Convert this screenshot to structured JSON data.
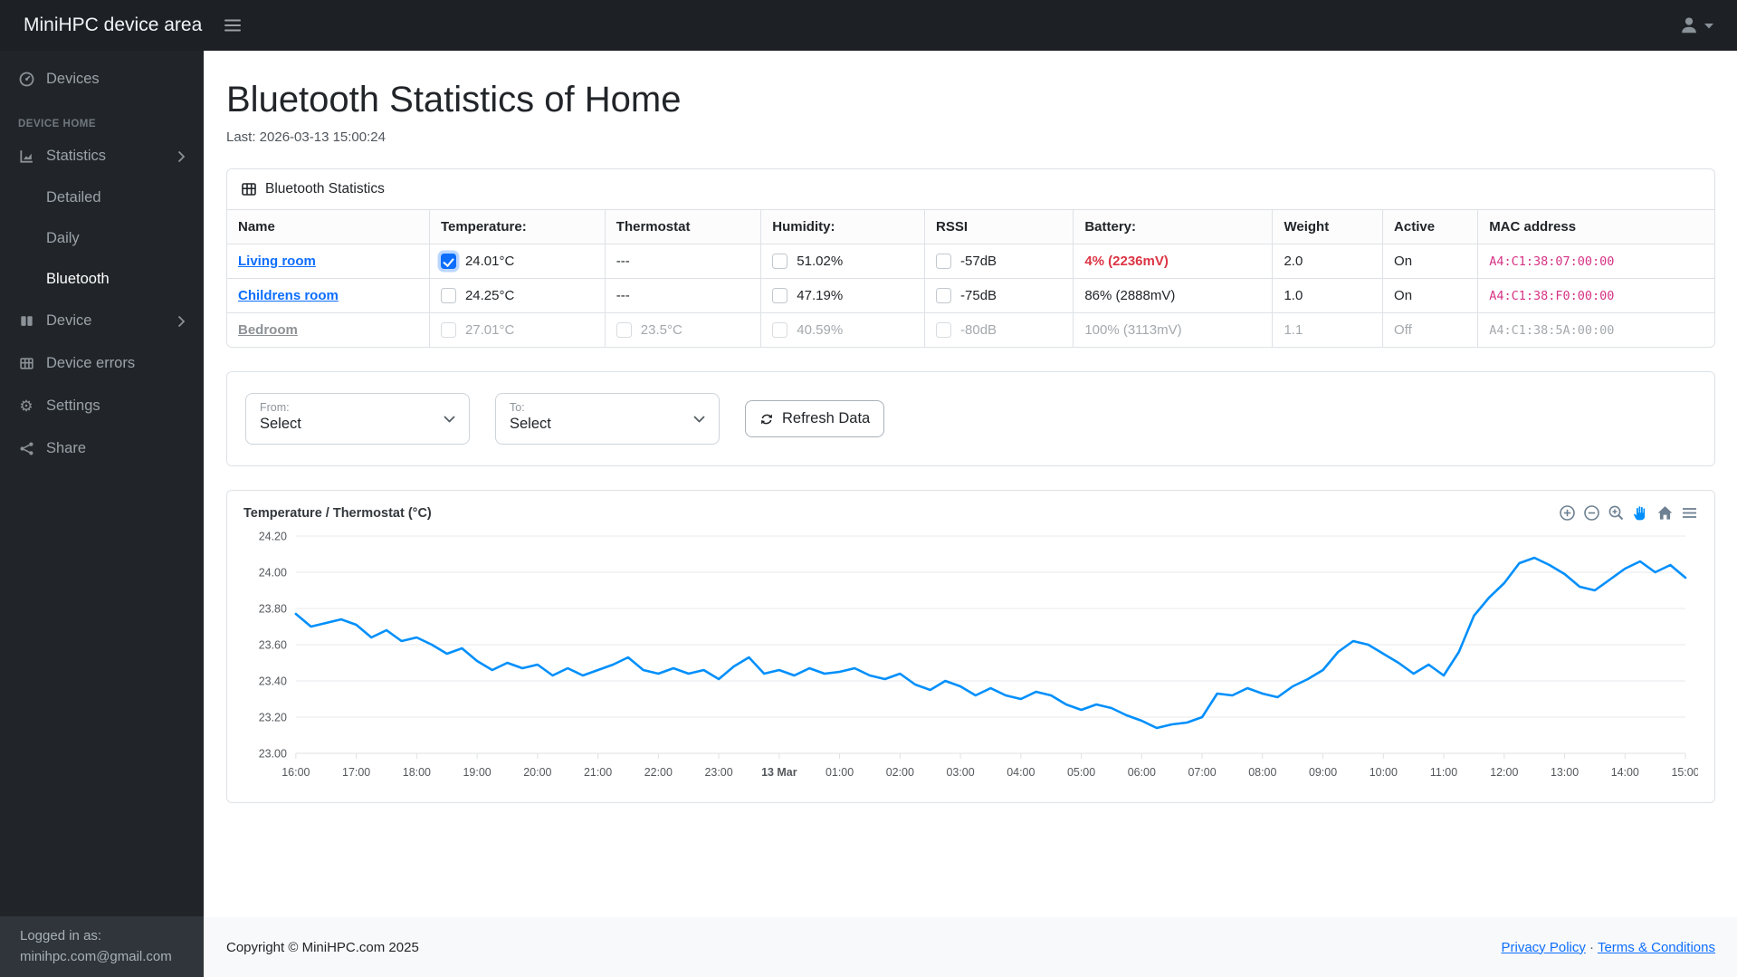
{
  "app": {
    "brand": "MiniHPC device area"
  },
  "sidebar": {
    "section_label": "DEVICE HOME",
    "items": {
      "devices": "Devices",
      "statistics": "Statistics",
      "detailed": "Detailed",
      "daily": "Daily",
      "bluetooth": "Bluetooth",
      "device": "Device",
      "device_errors": "Device errors",
      "settings": "Settings",
      "share": "Share"
    },
    "footer": {
      "line1": "Logged in as:",
      "line2": "minihpc.com@gmail.com"
    }
  },
  "page": {
    "title": "Bluetooth Statistics of Home",
    "last": "Last: 2026-03-13 15:00:24"
  },
  "stats_card": {
    "header": "Bluetooth Statistics",
    "columns": [
      "Name",
      "Temperature:",
      "Thermostat",
      "Humidity:",
      "RSSI",
      "Battery:",
      "Weight",
      "Active",
      "MAC address"
    ],
    "rows": [
      {
        "name": "Living room",
        "temp": "24.01°C",
        "temp_checked": true,
        "thermostat": "---",
        "humidity": "51.02%",
        "humidity_checked": false,
        "rssi": "-57dB",
        "rssi_checked": false,
        "battery": "4% (2236mV)",
        "battery_alert": true,
        "weight": "2.0",
        "active": "On",
        "mac": "A4:C1:38:07:00:00",
        "muted": false
      },
      {
        "name": "Childrens room",
        "temp": "24.25°C",
        "temp_checked": false,
        "thermostat": "---",
        "humidity": "47.19%",
        "humidity_checked": false,
        "rssi": "-75dB",
        "rssi_checked": false,
        "battery": "86% (2888mV)",
        "battery_alert": false,
        "weight": "1.0",
        "active": "On",
        "mac": "A4:C1:38:F0:00:00",
        "muted": false
      },
      {
        "name": "Bedroom",
        "temp": "27.01°C",
        "temp_checked": false,
        "thermostat": "23.5°C",
        "thermostat_checked": false,
        "humidity": "40.59%",
        "humidity_checked": false,
        "rssi": "-80dB",
        "rssi_checked": false,
        "battery": "100% (3113mV)",
        "battery_alert": false,
        "weight": "1.1",
        "active": "Off",
        "mac": "A4:C1:38:5A:00:00",
        "muted": true
      }
    ]
  },
  "filters": {
    "from_label": "From:",
    "from_value": "Select",
    "to_label": "To:",
    "to_value": "Select",
    "refresh_label": "Refresh Data"
  },
  "chart_data": {
    "type": "line",
    "title": "Temperature / Thermostat (°C)",
    "x_categories": [
      "16:00",
      "17:00",
      "18:00",
      "19:00",
      "20:00",
      "21:00",
      "22:00",
      "23:00",
      "13 Mar",
      "01:00",
      "02:00",
      "03:00",
      "04:00",
      "05:00",
      "06:00",
      "07:00",
      "08:00",
      "09:00",
      "10:00",
      "11:00",
      "12:00",
      "13:00",
      "14:00",
      "15:00"
    ],
    "bold_category_index": 8,
    "ylim": [
      23.0,
      24.2
    ],
    "ytick": 0.2,
    "x_hours_span": 23,
    "grid": true,
    "legend": "none",
    "toolbar": [
      "zoom-in",
      "zoom-out",
      "selection-zoom",
      "pan",
      "home",
      "menu"
    ],
    "series": [
      {
        "name": "Temperature",
        "color": "#008FFB",
        "points": [
          [
            0,
            23.77
          ],
          [
            0.25,
            23.7
          ],
          [
            0.5,
            23.72
          ],
          [
            0.75,
            23.74
          ],
          [
            1,
            23.71
          ],
          [
            1.25,
            23.64
          ],
          [
            1.5,
            23.68
          ],
          [
            1.75,
            23.62
          ],
          [
            2,
            23.64
          ],
          [
            2.25,
            23.6
          ],
          [
            2.5,
            23.55
          ],
          [
            2.75,
            23.58
          ],
          [
            3,
            23.51
          ],
          [
            3.25,
            23.46
          ],
          [
            3.5,
            23.5
          ],
          [
            3.75,
            23.47
          ],
          [
            4,
            23.49
          ],
          [
            4.25,
            23.43
          ],
          [
            4.5,
            23.47
          ],
          [
            4.75,
            23.43
          ],
          [
            5,
            23.46
          ],
          [
            5.25,
            23.49
          ],
          [
            5.5,
            23.53
          ],
          [
            5.75,
            23.46
          ],
          [
            6,
            23.44
          ],
          [
            6.25,
            23.47
          ],
          [
            6.5,
            23.44
          ],
          [
            6.75,
            23.46
          ],
          [
            7,
            23.41
          ],
          [
            7.25,
            23.48
          ],
          [
            7.5,
            23.53
          ],
          [
            7.75,
            23.44
          ],
          [
            8,
            23.46
          ],
          [
            8.25,
            23.43
          ],
          [
            8.5,
            23.47
          ],
          [
            8.75,
            23.44
          ],
          [
            9,
            23.45
          ],
          [
            9.25,
            23.47
          ],
          [
            9.5,
            23.43
          ],
          [
            9.75,
            23.41
          ],
          [
            10,
            23.44
          ],
          [
            10.25,
            23.38
          ],
          [
            10.5,
            23.35
          ],
          [
            10.75,
            23.4
          ],
          [
            11,
            23.37
          ],
          [
            11.25,
            23.32
          ],
          [
            11.5,
            23.36
          ],
          [
            11.75,
            23.32
          ],
          [
            12,
            23.3
          ],
          [
            12.25,
            23.34
          ],
          [
            12.5,
            23.32
          ],
          [
            12.75,
            23.27
          ],
          [
            13,
            23.24
          ],
          [
            13.25,
            23.27
          ],
          [
            13.5,
            23.25
          ],
          [
            13.75,
            23.21
          ],
          [
            14,
            23.18
          ],
          [
            14.25,
            23.14
          ],
          [
            14.5,
            23.16
          ],
          [
            14.75,
            23.17
          ],
          [
            15,
            23.2
          ],
          [
            15.25,
            23.33
          ],
          [
            15.5,
            23.32
          ],
          [
            15.75,
            23.36
          ],
          [
            16,
            23.33
          ],
          [
            16.25,
            23.31
          ],
          [
            16.5,
            23.37
          ],
          [
            16.75,
            23.41
          ],
          [
            17,
            23.46
          ],
          [
            17.25,
            23.56
          ],
          [
            17.5,
            23.62
          ],
          [
            17.75,
            23.6
          ],
          [
            18,
            23.55
          ],
          [
            18.25,
            23.5
          ],
          [
            18.5,
            23.44
          ],
          [
            18.75,
            23.49
          ],
          [
            19,
            23.43
          ],
          [
            19.25,
            23.56
          ],
          [
            19.5,
            23.76
          ],
          [
            19.75,
            23.86
          ],
          [
            20,
            23.94
          ],
          [
            20.25,
            24.05
          ],
          [
            20.5,
            24.08
          ],
          [
            20.75,
            24.04
          ],
          [
            21,
            23.99
          ],
          [
            21.25,
            23.92
          ],
          [
            21.5,
            23.9
          ],
          [
            21.75,
            23.96
          ],
          [
            22,
            24.02
          ],
          [
            22.25,
            24.06
          ],
          [
            22.5,
            24.0
          ],
          [
            22.75,
            24.04
          ],
          [
            23,
            23.97
          ]
        ]
      }
    ]
  },
  "footer": {
    "copyright": "Copyright © MiniHPC.com 2025",
    "links": [
      "Privacy Policy",
      "Terms & Conditions"
    ],
    "separator": "·"
  },
  "colors": {
    "accent": "#0d6efd",
    "line": "#008FFB",
    "danger": "#dc3545",
    "mac_pink": "#d63384",
    "sidebar_bg": "#212529",
    "topbar_bg": "#1d2125"
  }
}
